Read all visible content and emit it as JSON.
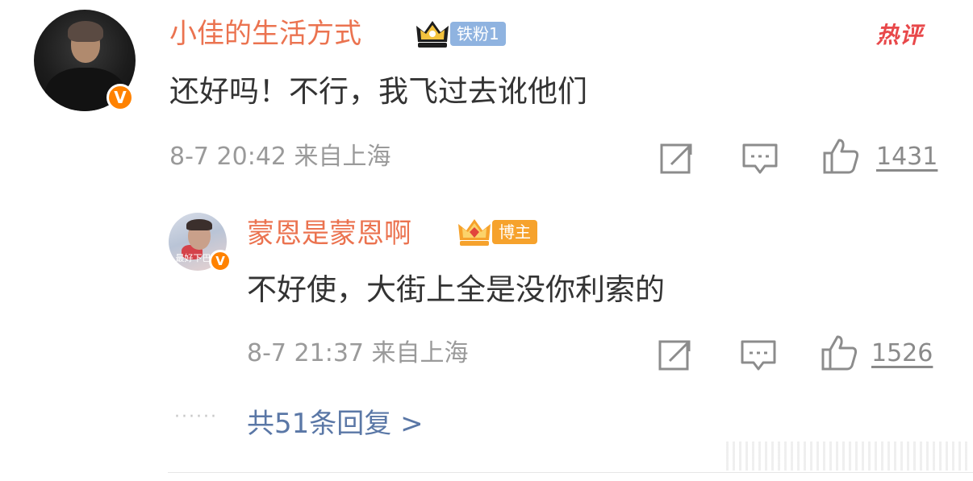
{
  "comment": {
    "username": "小佳的生活方式",
    "badge_label": "铁粉1",
    "hot_label": "热评",
    "text": "还好吗！不行，我飞过去讹他们",
    "meta": "8-7 20:42 来自上海",
    "likes": "1431",
    "verified_mark": "V"
  },
  "reply": {
    "username": "蒙恩是蒙恩啊",
    "badge_label": "博主",
    "avatar_caption": "最好下巴啦",
    "text": "不好使，大街上全是没你利索的",
    "meta": "8-7 21:37 来自上海",
    "likes": "1526",
    "verified_mark": "V"
  },
  "more": {
    "dots": "······",
    "label": "共51条回复 >"
  },
  "colors": {
    "username": "#eb7350",
    "link": "#5a77a6",
    "meta": "#9a9a9a",
    "verified": "#ff8200",
    "hot": "#e8484a"
  },
  "icons": [
    "repost-icon",
    "comment-icon",
    "like-icon",
    "crown-icon",
    "verified-icon"
  ]
}
